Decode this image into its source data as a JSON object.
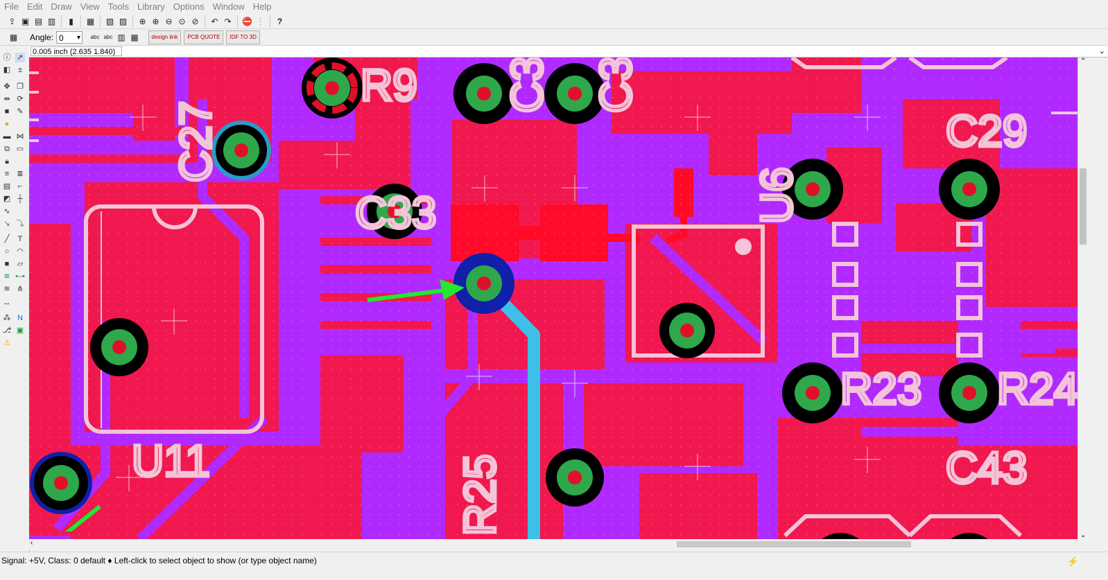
{
  "menu": [
    "File",
    "Edit",
    "Draw",
    "View",
    "Tools",
    "Library",
    "Options",
    "Window",
    "Help"
  ],
  "toolbar2": {
    "angle_label": "Angle:",
    "angle_value": "0",
    "btn_design": "design link",
    "btn_quote": "PCB QUOTE",
    "btn_idf": "IDF TO 3D"
  },
  "coord": {
    "value": "0.005 inch (2.635 1.840)"
  },
  "canvas": {
    "labels": [
      "R9",
      "C27",
      "C33",
      "U11",
      "R25",
      "C29",
      "U6",
      "R23",
      "R24",
      "C43",
      "C3",
      "C3"
    ],
    "colors": {
      "pour_top": "#f0184e",
      "pour_bottom": "#b02aff",
      "silk": "#f4c4d8",
      "pad_red": "#ff0a28",
      "trace_cyan": "#3cc0e8",
      "marker_green": "#22e832"
    }
  },
  "status": {
    "text": "Signal: +5V, Class: 0 default  ♦ Left-click to select object to show (or type object name)"
  }
}
